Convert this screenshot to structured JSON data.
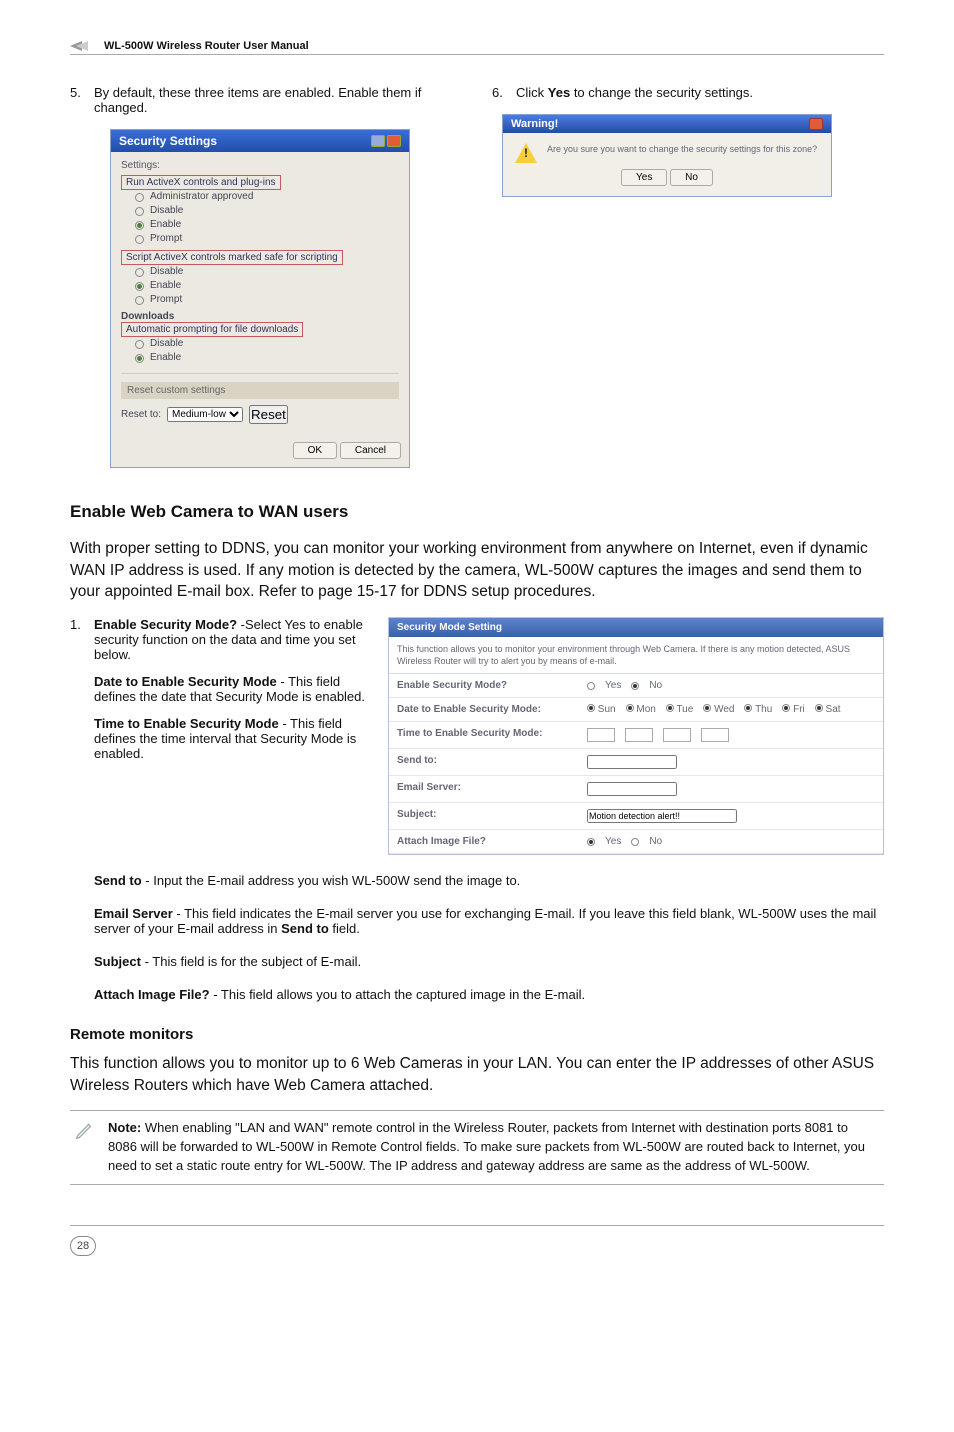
{
  "header": {
    "product": "WL-500W Wireless Router User Manual"
  },
  "step5": {
    "num": "5.",
    "text": "By default, these three items are enabled. Enable them if changed."
  },
  "step6": {
    "num": "6.",
    "text_pre": "Click ",
    "text_bold": "Yes",
    "text_post": " to change the security settings."
  },
  "dlg1": {
    "title": "Security Settings",
    "settings_label": "Settings:",
    "g1_head": "Run ActiveX controls and plug-ins",
    "opt_admin": "Administrator approved",
    "opt_disable": "Disable",
    "opt_enable": "Enable",
    "opt_prompt": "Prompt",
    "g2_head": "Script ActiveX controls marked safe for scripting",
    "downloads": "Downloads",
    "g3_head": "Automatic prompting for file downloads",
    "reset_section": "Reset custom settings",
    "reset_to": "Reset to:",
    "reset_sel": "Medium-low",
    "reset_btn": "Reset",
    "ok": "OK",
    "cancel": "Cancel"
  },
  "dlg2": {
    "title": "Warning!",
    "msg": "Are you sure you want to change the security settings for this zone?",
    "yes": "Yes",
    "no": "No"
  },
  "section1": {
    "title": "Enable Web Camera to WAN users",
    "para": "With proper setting to DDNS, you can monitor your working environment from anywhere on Internet, even if dynamic WAN IP address is used. If any motion is detected by the camera, WL-500W captures the images and send them to your appointed E-mail box. Refer to page 15-17 for DDNS setup procedures."
  },
  "list1": {
    "num": "1.",
    "l1a": "Enable Security Mode?",
    "l1b": " -Select Yes to enable security function on the data and time you set below.",
    "l2a": "Date to Enable Security Mode",
    "l2b": " - This field defines the date that Security Mode is enabled.",
    "l3a": "Time to Enable Security Mode",
    "l3b": " - This field defines the time interval that Security Mode is enabled."
  },
  "settbl": {
    "head": "Security Mode Setting",
    "desc": "This function allows you to monitor your environment through Web Camera. If there is any motion detected, ASUS Wireless Router will try to alert you by means of e-mail.",
    "r1": "Enable Security Mode?",
    "r1_yes": "Yes",
    "r1_no": "No",
    "r2": "Date to Enable Security Mode:",
    "r2_opts": [
      "Sun",
      "Mon",
      "Tue",
      "Wed",
      "Thu",
      "Fri",
      "Sat"
    ],
    "r3": "Time to Enable Security Mode:",
    "r4": "Send to:",
    "r5": "Email Server:",
    "r6": "Subject:",
    "r6_val": "Motion detection alert!!",
    "r7": "Attach Image File?",
    "r7_yes": "Yes",
    "r7_no": "No"
  },
  "after": {
    "p1a": "Send to",
    "p1b": " - Input the E-mail address you wish WL-500W send the image to.",
    "p2a": "Email Server",
    "p2b": " - This field indicates the E-mail server you use for exchanging E-mail. If you leave this field blank, WL-500W uses the mail server of your E-mail address in ",
    "p2c": "Send to",
    "p2d": " field.",
    "p3a": "Subject",
    "p3b": " - This field is for the subject of E-mail.",
    "p4a": "Attach Image File?",
    "p4b": " - This field allows you to attach the captured image in the E-mail."
  },
  "section2": {
    "title": "Remote monitors",
    "para": "This function allows you to monitor up to 6 Web Cameras in your LAN. You can enter the IP addresses of other ASUS Wireless Routers which have Web Camera attached."
  },
  "note": {
    "label": "Note:",
    "text": " When enabling \"LAN and WAN\" remote control in the Wireless Router, packets from Internet with destination ports 8081 to 8086 will be forwarded to WL-500W in Remote Control fields. To make sure packets from WL-500W are routed back to Internet, you need to set a static route entry for WL-500W. The IP address and gateway address are same as the address of WL-500W."
  },
  "footer": {
    "page": "28"
  }
}
